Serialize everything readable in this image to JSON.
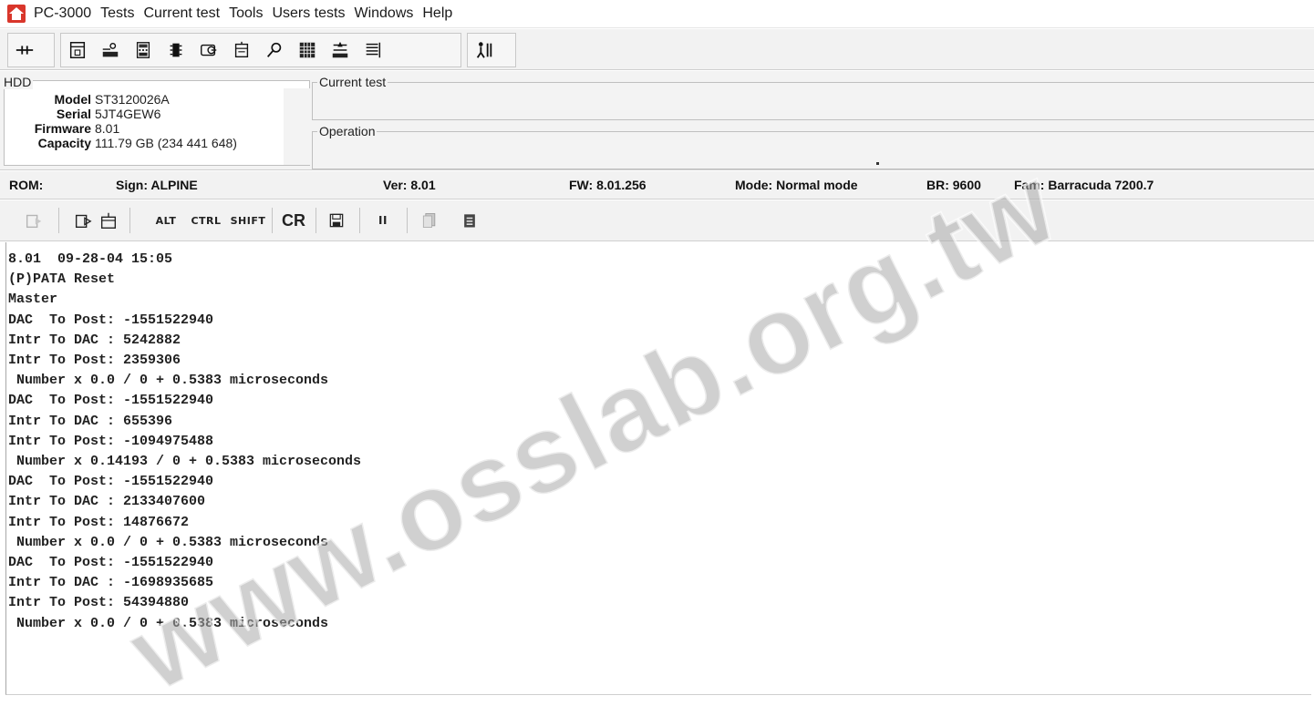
{
  "menu": {
    "app_title": "PC-3000",
    "items": [
      "Tests",
      "Current test",
      "Tools",
      "Users tests",
      "Windows",
      "Help"
    ]
  },
  "toolbar": {
    "icons": [
      "connector-icon",
      "device-icon",
      "drive-tools-icon",
      "calculator-icon",
      "chip-icon",
      "disk-icon",
      "database-icon",
      "search-icon",
      "grid-icon",
      "sliders-icon",
      "list-icon",
      "user-help-icon"
    ]
  },
  "hdd": {
    "legend": "HDD",
    "model_label": "Model",
    "model": "ST3120026A",
    "serial_label": "Serial",
    "serial": "5JT4GEW6",
    "firmware_label": "Firmware",
    "firmware": "8.01",
    "capacity_label": "Capacity",
    "capacity": "111.79 GB (234 441 648)"
  },
  "current_test": {
    "legend": "Current test"
  },
  "operation": {
    "legend": "Operation"
  },
  "rom_line": {
    "rom": "ROM:",
    "sign": "Sign: ALPINE",
    "ver": "Ver: 8.01",
    "fw": "FW: 8.01.256",
    "mode": "Mode: Normal mode",
    "br": "BR: 9600",
    "fam": "Fam: Barracuda 7200.7"
  },
  "toolbar2": {
    "alt": "ALT",
    "ctrl": "CTRL",
    "shift": "SHIFT",
    "cr": "CR",
    "pause": "II"
  },
  "log_lines": [
    "8.01  09-28-04 15:05",
    "(P)PATA Reset",
    "Master",
    "DAC  To Post: -1551522940",
    "Intr To DAC : 5242882",
    "Intr To Post: 2359306",
    " Number x 0.0 / 0 + 0.5383 microseconds",
    "DAC  To Post: -1551522940",
    "Intr To DAC : 655396",
    "Intr To Post: -1094975488",
    " Number x 0.14193 / 0 + 0.5383 microseconds",
    "DAC  To Post: -1551522940",
    "Intr To DAC : 2133407600",
    "Intr To Post: 14876672",
    " Number x 0.0 / 0 + 0.5383 microseconds",
    "DAC  To Post: -1551522940",
    "Intr To DAC : -1698935685",
    "Intr To Post: 54394880",
    " Number x 0.0 / 0 + 0.5383 microseconds"
  ],
  "watermark": "www.osslab.org.tw"
}
